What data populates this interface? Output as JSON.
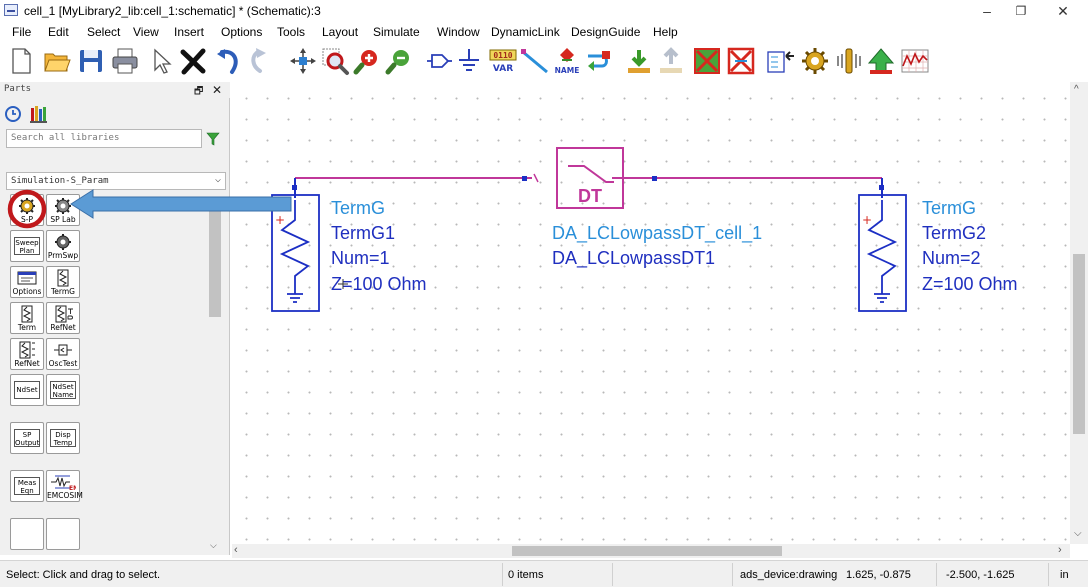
{
  "window": {
    "title": "cell_1 [MyLibrary2_lib:cell_1:schematic] * (Schematic):3",
    "minimize": "–",
    "restore": "❐",
    "close": "✕"
  },
  "menu": [
    "File",
    "Edit",
    "Select",
    "View",
    "Insert",
    "Options",
    "Tools",
    "Layout",
    "Simulate",
    "Window",
    "DynamicLink",
    "DesignGuide",
    "Help"
  ],
  "toolbar": {
    "var_label_top": "0110",
    "var_label_bottom": "VAR",
    "name_label": "NAME"
  },
  "parts_panel": {
    "header": "Parts",
    "float_glyph": "🗗",
    "close_glyph": "✕",
    "search_placeholder": "Search all libraries",
    "library": "Simulation-S_Param",
    "items": [
      {
        "label": "S-P"
      },
      {
        "label": "SP Lab"
      },
      {
        "box": "Sweep\nPlan",
        "label": ""
      },
      {
        "label": "PrmSwp"
      },
      {
        "label": "Options"
      },
      {
        "label": "TermG"
      },
      {
        "label": "Term"
      },
      {
        "label": "RefNet"
      },
      {
        "label": "RefNet"
      },
      {
        "label": "OscTest"
      },
      {
        "box": "NdSet",
        "label": ""
      },
      {
        "box": "NdSet\nName",
        "label": ""
      },
      {
        "box": "SP\nOutput",
        "label": ""
      },
      {
        "box": "Disp\nTemp",
        "label": ""
      },
      {
        "box": "Meas\nEqn",
        "label": ""
      },
      {
        "label": "EMCOSIM"
      }
    ]
  },
  "schematic": {
    "term1": {
      "type": "TermG",
      "name": "TermG1",
      "num": "Num=1",
      "z": "Z=100 Ohm"
    },
    "term2": {
      "type": "TermG",
      "name": "TermG2",
      "num": "Num=2",
      "z": "Z=100 Ohm"
    },
    "dut": {
      "block_label": "DT",
      "cell": "DA_LCLowpassDT_cell_1",
      "instance": "DA_LCLowpassDT1"
    },
    "colors": {
      "wire": "#c0379a",
      "component": "#1c2fc4",
      "label": "#2a8fd9",
      "param": "#1f2fbf",
      "highlight_circle": "#c0181b",
      "arrow": "#5b9bd5"
    }
  },
  "status": {
    "message": "Select: Click and drag to select.",
    "items": "0 items",
    "layer": "ads_device:drawing",
    "coord1": "1.625, -0.875",
    "coord2": "-2.500, -1.625",
    "unit": "in"
  }
}
